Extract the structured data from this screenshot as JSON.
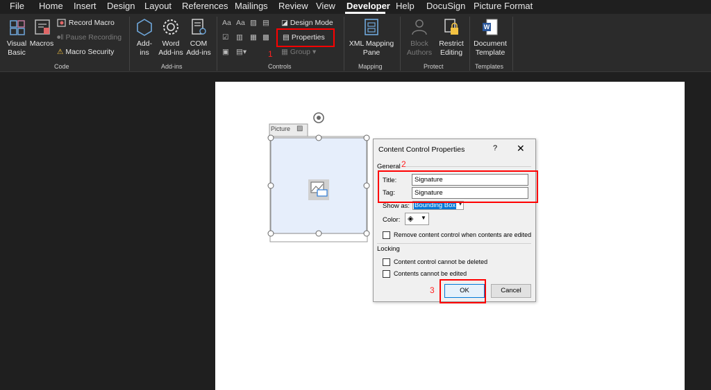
{
  "menu": {
    "tabs": [
      "File",
      "Home",
      "Insert",
      "Design",
      "Layout",
      "References",
      "Mailings",
      "Review",
      "View",
      "Developer",
      "Help",
      "DocuSign",
      "Picture Format"
    ],
    "active": "Developer"
  },
  "ribbon": {
    "code": {
      "label": "Code",
      "visual_basic": [
        "Visual",
        "Basic"
      ],
      "macros": "Macros",
      "record_macro": "Record Macro",
      "pause_recording": "Pause Recording",
      "macro_security": "Macro Security"
    },
    "addins": {
      "label": "Add-ins",
      "addins": [
        "Add-",
        "ins"
      ],
      "word_addins": [
        "Word",
        "Add-ins"
      ],
      "com_addins": [
        "COM",
        "Add-ins"
      ]
    },
    "controls": {
      "label": "Controls",
      "design_mode": "Design Mode",
      "properties": "Properties",
      "group": "Group"
    },
    "mapping": {
      "label": "Mapping",
      "xml_mapping_pane": [
        "XML Mapping",
        "Pane"
      ]
    },
    "protect": {
      "label": "Protect",
      "block_authors": [
        "Block",
        "Authors"
      ],
      "restrict_editing": [
        "Restrict",
        "Editing"
      ]
    },
    "templates": {
      "label": "Templates",
      "document_template": [
        "Document",
        "Template"
      ]
    }
  },
  "steps": [
    "1",
    "2",
    "3"
  ],
  "picture_control": {
    "tag_label": "Picture"
  },
  "dialog": {
    "title": "Content Control Properties",
    "help": "?",
    "close": "✕",
    "general_section": "General",
    "title_label": "Title:",
    "title_value": "Signature",
    "tag_label": "Tag:",
    "tag_value": "Signature",
    "show_as_label": "Show as:",
    "show_as_value": "Bounding Box",
    "color_label": "Color:",
    "remove_label": "Remove content control when contents are edited",
    "locking_section": "Locking",
    "cannot_delete_label": "Content control cannot be deleted",
    "cannot_edit_label": "Contents cannot be edited",
    "ok_label": "OK",
    "cancel_label": "Cancel"
  },
  "colors": {
    "highlight": "#ff0000",
    "accent": "#0078d7"
  }
}
